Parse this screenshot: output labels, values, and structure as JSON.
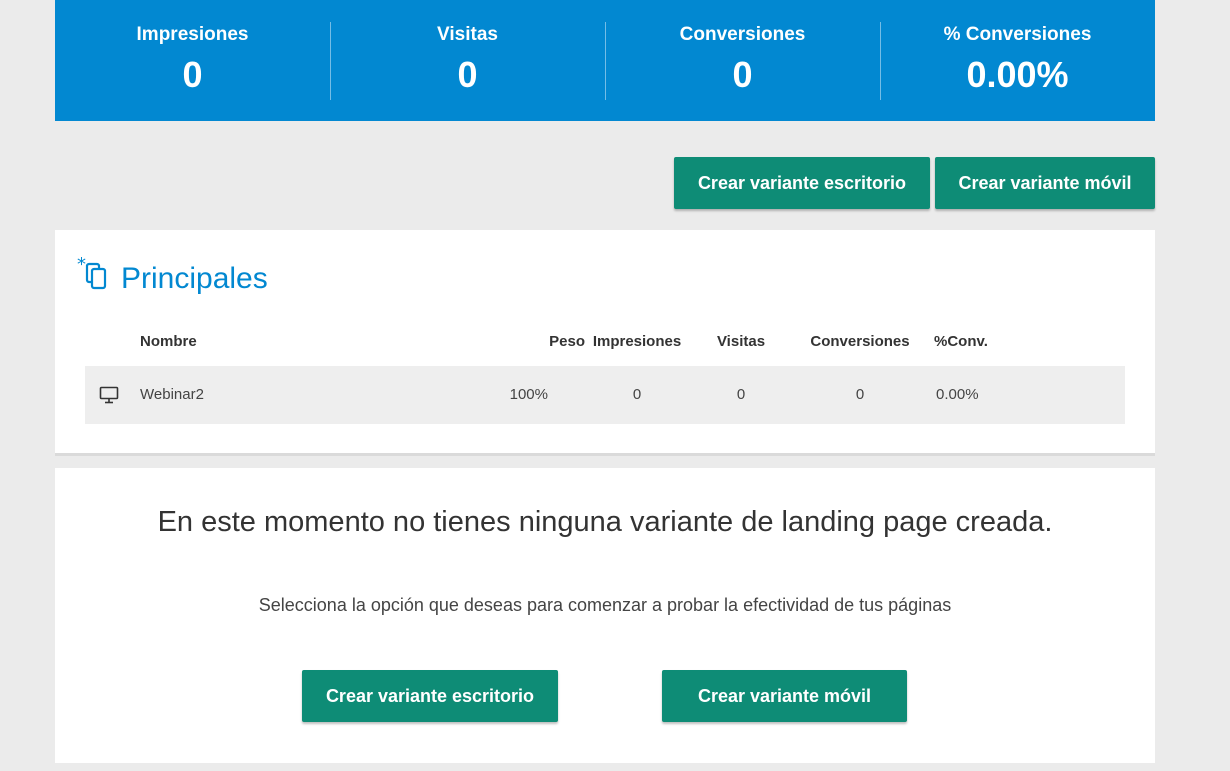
{
  "stats": [
    {
      "label": "Impresiones",
      "value": "0"
    },
    {
      "label": "Visitas",
      "value": "0"
    },
    {
      "label": "Conversiones",
      "value": "0"
    },
    {
      "label": "% Conversiones",
      "value": "0.00%"
    }
  ],
  "actions": {
    "desktop_label": "Crear variante escritorio",
    "mobile_label": "Crear variante móvil"
  },
  "principales": {
    "title": "Principales",
    "icon": "copy-pages-icon",
    "columns": {
      "nombre": "Nombre",
      "peso": "Peso",
      "impresiones": "Impresiones",
      "visitas": "Visitas",
      "conversiones": "Conversiones",
      "conv_pct": "%Conv."
    },
    "rows": [
      {
        "device_icon": "desktop-icon",
        "nombre": "Webinar2",
        "peso": "100%",
        "impresiones": "0",
        "visitas": "0",
        "conversiones": "0",
        "conv_pct": "0.00%"
      }
    ]
  },
  "empty_state": {
    "title": "En este momento no tienes ninguna variante de landing page creada.",
    "subtitle": "Selecciona la opción que deseas para comenzar a probar la efectividad de tus páginas",
    "desktop_label": "Crear variante escritorio",
    "mobile_label": "Crear variante móvil"
  },
  "colors": {
    "stats_background": "#0288d1",
    "button_green": "#0e8c76",
    "accent_blue": "#0288d1"
  }
}
